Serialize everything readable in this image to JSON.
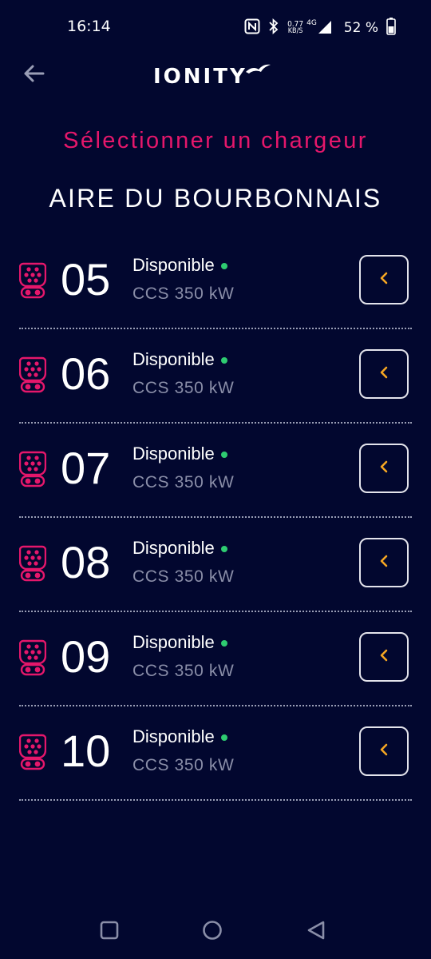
{
  "status_bar": {
    "time": "16:14",
    "net_speed_value": "0.77",
    "net_speed_unit": "KB/S",
    "network": "4G",
    "battery": "52 %",
    "icons": [
      "nfc-icon",
      "bluetooth-icon",
      "signal-icon",
      "battery-icon"
    ]
  },
  "header": {
    "back_icon": "arrow-left-icon",
    "logo_text": "IONITY"
  },
  "page_title": "Sélectionner un chargeur",
  "station_name": "AIRE DU BOURBONNAIS",
  "chargers": [
    {
      "number": "05",
      "status": "Disponible",
      "type": "CCS 350 kW"
    },
    {
      "number": "06",
      "status": "Disponible",
      "type": "CCS 350 kW"
    },
    {
      "number": "07",
      "status": "Disponible",
      "type": "CCS 350 kW"
    },
    {
      "number": "08",
      "status": "Disponible",
      "type": "CCS 350 kW"
    },
    {
      "number": "09",
      "status": "Disponible",
      "type": "CCS 350 kW"
    },
    {
      "number": "10",
      "status": "Disponible",
      "type": "CCS 350 kW"
    }
  ],
  "colors": {
    "background": "#02072f",
    "accent_pink": "#e5176b",
    "available_green": "#2ecc71",
    "chevron_orange": "#f5a623",
    "muted_text": "#8a8ea8"
  },
  "nav_bar": {
    "icons": [
      "recents-square-icon",
      "home-circle-icon",
      "back-triangle-icon"
    ]
  }
}
